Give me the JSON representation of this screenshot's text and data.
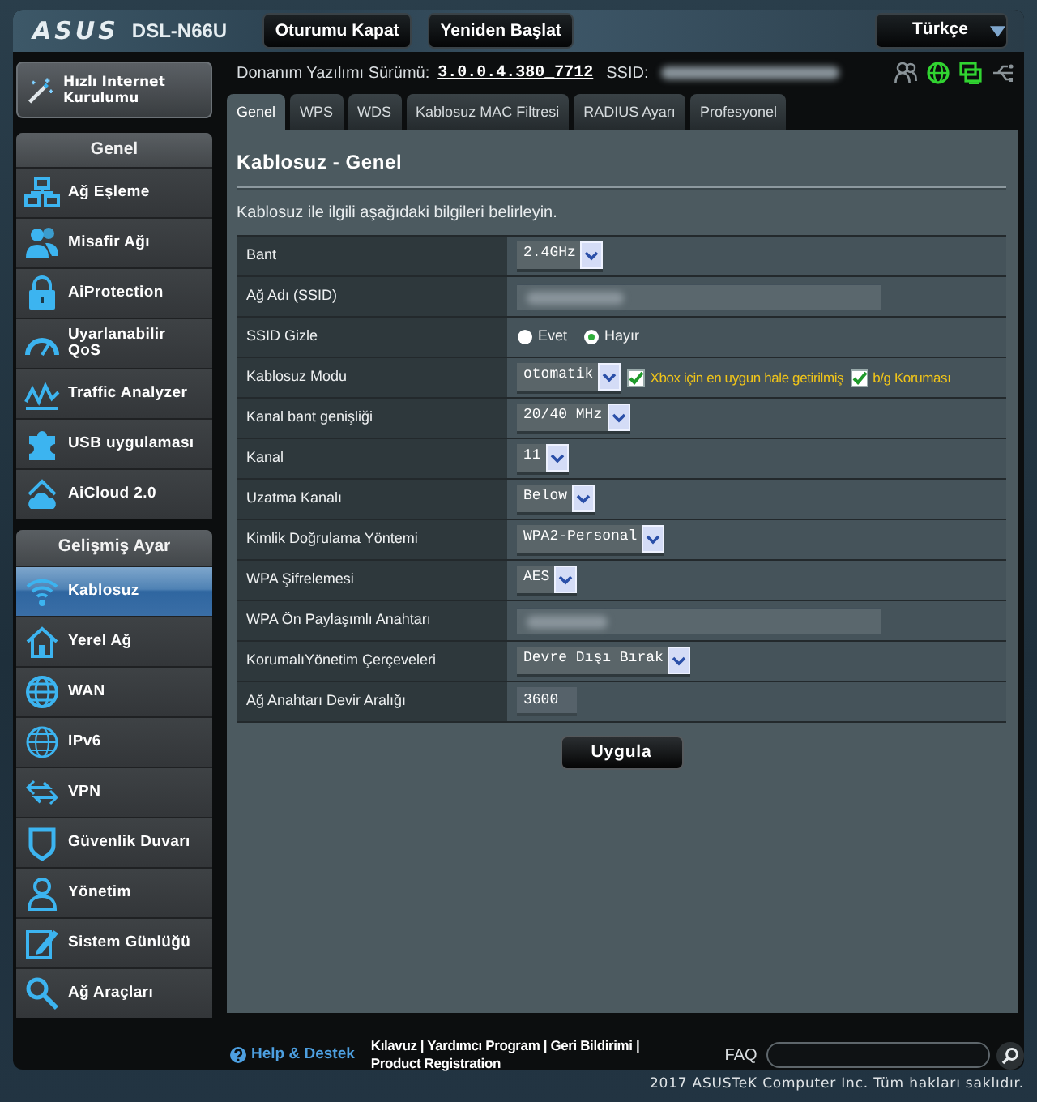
{
  "header": {
    "logo": "ASUS",
    "model": "DSL-N66U",
    "buttons": [
      "Oturumu Kapat",
      "Yeniden Başlat"
    ],
    "language": "Türkçe"
  },
  "quick_setup": {
    "label": "Hızlı Internet Kurulumu"
  },
  "sidebar": {
    "sections": [
      {
        "title": "Genel",
        "items": [
          {
            "label": "Ağ Eşleme",
            "selected": false
          },
          {
            "label": "Misafir Ağı",
            "selected": false
          },
          {
            "label": "AiProtection",
            "selected": false
          },
          {
            "label": "Uyarlanabilir QoS",
            "selected": false
          },
          {
            "label": "Traffic Analyzer",
            "selected": false
          },
          {
            "label": "USB uygulaması",
            "selected": false
          },
          {
            "label": "AiCloud 2.0",
            "selected": false
          }
        ]
      },
      {
        "title": "Gelişmiş Ayar",
        "items": [
          {
            "label": "Kablosuz",
            "selected": true
          },
          {
            "label": "Yerel Ağ",
            "selected": false
          },
          {
            "label": "WAN",
            "selected": false
          },
          {
            "label": "IPv6",
            "selected": false
          },
          {
            "label": "VPN",
            "selected": false
          },
          {
            "label": "Güvenlik Duvarı",
            "selected": false
          },
          {
            "label": "Yönetim",
            "selected": false
          },
          {
            "label": "Sistem Günlüğü",
            "selected": false
          },
          {
            "label": "Ağ Araçları",
            "selected": false
          }
        ]
      }
    ]
  },
  "info": {
    "firmware_label": "Donanım Yazılımı Sürümü:",
    "firmware_version": "3.0.0.4.380_7712",
    "ssid_label": "SSID:",
    "ssid_redacted": true,
    "status_icons": [
      {
        "on": false
      },
      {
        "on": true
      },
      {
        "on": true
      },
      {
        "on": false
      }
    ]
  },
  "tabs": [
    {
      "label": "Genel",
      "selected": true
    },
    {
      "label": "WPS",
      "selected": false
    },
    {
      "label": "WDS",
      "selected": false
    },
    {
      "label": "Kablosuz MAC Filtresi",
      "selected": false
    },
    {
      "label": "RADIUS Ayarı",
      "selected": false
    },
    {
      "label": "Profesyonel",
      "selected": false
    }
  ],
  "panel": {
    "title": "Kablosuz - Genel",
    "description": "Kablosuz ile ilgili aşağıdaki bilgileri belirleyin.",
    "settings": [
      {
        "label": "Bant",
        "kind": "select",
        "value": "2.4GHz"
      },
      {
        "label": "Ağ Adı (SSID)",
        "kind": "text",
        "redacted": true
      },
      {
        "label": "SSID Gizle",
        "kind": "radio",
        "options": [
          {
            "label": "Evet",
            "selected": false
          },
          {
            "label": "Hayır",
            "selected": true
          }
        ]
      },
      {
        "label": "Kablosuz Modu",
        "kind": "select",
        "value": "otomatik",
        "checkboxes": [
          {
            "label": "Xbox için en uygun hale getirilmiş",
            "checked": true
          },
          {
            "label": "b/g Koruması",
            "checked": true
          }
        ]
      },
      {
        "label": "Kanal bant genişliği",
        "kind": "select",
        "value": "20/40 MHz"
      },
      {
        "label": "Kanal",
        "kind": "select",
        "value": "11"
      },
      {
        "label": "Uzatma Kanalı",
        "kind": "select",
        "value": "Below"
      },
      {
        "label": "Kimlik Doğrulama Yöntemi",
        "kind": "select",
        "value": "WPA2-Personal"
      },
      {
        "label": "WPA Şifrelemesi",
        "kind": "select",
        "value": "AES"
      },
      {
        "label": "WPA Ön Paylaşımlı Anahtarı",
        "kind": "text",
        "redacted": true
      },
      {
        "label": "KorumalıYönetim Çerçeveleri",
        "kind": "select",
        "value": "Devre Dışı Bırak"
      },
      {
        "label": "Ağ Anahtarı Devir Aralığı",
        "kind": "text",
        "value": "3600"
      }
    ],
    "apply_button": "Uygula"
  },
  "footer": {
    "help": "Help & Destek",
    "links": [
      "Kılavuz",
      "Yardımcı Program",
      "Geri Bildirimi",
      "Product Registration"
    ],
    "link_separator": "|",
    "faq_label": "FAQ"
  },
  "copyright": "2017 ASUSTeK Computer Inc. Tüm hakları saklıdır."
}
